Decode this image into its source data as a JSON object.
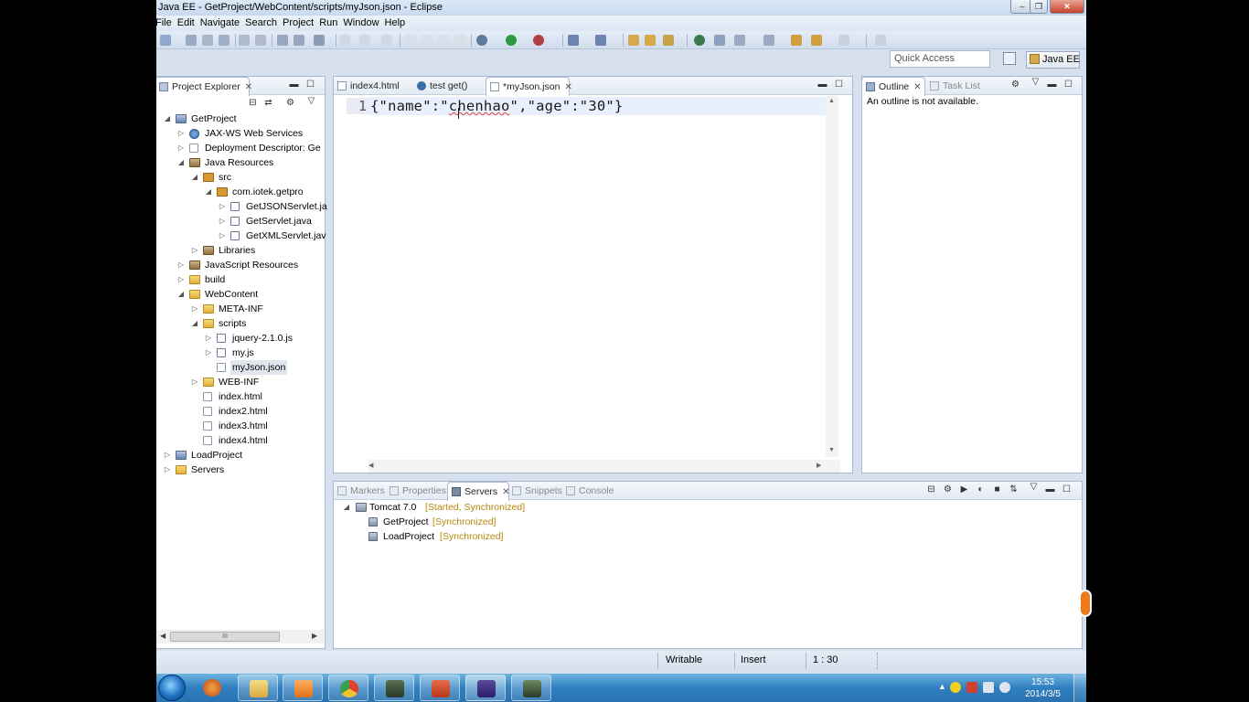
{
  "window": {
    "title": "Java EE - GetProject/WebContent/scripts/myJson.json - Eclipse",
    "controls": {
      "minimize": "‒",
      "restore": "❐",
      "close": "✕"
    }
  },
  "menu": [
    "File",
    "Edit",
    "Navigate",
    "Search",
    "Project",
    "Run",
    "Window",
    "Help"
  ],
  "quick_access": {
    "placeholder": "Quick Access"
  },
  "perspective": {
    "label": "Java EE"
  },
  "project_explorer": {
    "tab_label": "Project Explorer",
    "tree": [
      {
        "label": "GetProject",
        "twisty": "◢",
        "icon": "project-icon"
      },
      {
        "label": "JAX-WS Web Services",
        "twisty": "▷",
        "icon": "web-services-icon"
      },
      {
        "label": "Deployment Descriptor: Ge",
        "twisty": "▷",
        "icon": "descriptor-icon"
      },
      {
        "label": "Java Resources",
        "twisty": "◢",
        "icon": "java-resources-icon"
      },
      {
        "label": "src",
        "twisty": "◢",
        "icon": "source-folder-icon"
      },
      {
        "label": "com.iotek.getpro",
        "twisty": "◢",
        "icon": "package-icon"
      },
      {
        "label": "GetJSONServlet.ja",
        "twisty": "▷",
        "icon": "java-file-icon"
      },
      {
        "label": "GetServlet.java",
        "twisty": "▷",
        "icon": "java-file-icon"
      },
      {
        "label": "GetXMLServlet.jav",
        "twisty": "▷",
        "icon": "java-file-icon"
      },
      {
        "label": "Libraries",
        "twisty": "▷",
        "icon": "library-icon"
      },
      {
        "label": "JavaScript Resources",
        "twisty": "▷",
        "icon": "javascript-resources-icon"
      },
      {
        "label": "build",
        "twisty": "▷",
        "icon": "folder-icon"
      },
      {
        "label": "WebContent",
        "twisty": "◢",
        "icon": "folder-icon"
      },
      {
        "label": "META-INF",
        "twisty": "▷",
        "icon": "folder-icon"
      },
      {
        "label": "scripts",
        "twisty": "◢",
        "icon": "folder-icon"
      },
      {
        "label": "jquery-2.1.0.js",
        "twisty": "▷",
        "icon": "js-file-icon"
      },
      {
        "label": "my.js",
        "twisty": "▷",
        "icon": "js-file-icon"
      },
      {
        "label": "myJson.json",
        "twisty": "",
        "icon": "file-icon"
      },
      {
        "label": "WEB-INF",
        "twisty": "▷",
        "icon": "folder-icon"
      },
      {
        "label": "index.html",
        "twisty": "",
        "icon": "html-file-icon"
      },
      {
        "label": "index2.html",
        "twisty": "",
        "icon": "html-file-icon"
      },
      {
        "label": "index3.html",
        "twisty": "",
        "icon": "html-file-icon"
      },
      {
        "label": "index4.html",
        "twisty": "",
        "icon": "html-file-icon"
      },
      {
        "label": "LoadProject",
        "twisty": "▷",
        "icon": "project-icon"
      },
      {
        "label": "Servers",
        "twisty": "▷",
        "icon": "folder-icon"
      }
    ],
    "hscroll_grip": "III"
  },
  "editor": {
    "tabs": [
      {
        "label": "index4.html",
        "active": false
      },
      {
        "label": "test get()",
        "active": false
      },
      {
        "label": "*myJson.json",
        "active": true
      }
    ],
    "line_number": "1",
    "code_before": "{\"name\":\"",
    "code_squiggle": "chenhao",
    "code_after": "\",\"age\":\"30\"}"
  },
  "outline": {
    "tabs": [
      "Outline",
      "Task List"
    ],
    "message": "An outline is not available."
  },
  "bottom_panel": {
    "tabs": [
      "Markers",
      "Properties",
      "Servers",
      "Snippets",
      "Console"
    ],
    "servers": [
      {
        "name": "Tomcat 7.0",
        "state": "[Started, Synchronized]",
        "children": [
          {
            "name": "GetProject",
            "state": "[Synchronized]"
          },
          {
            "name": "LoadProject",
            "state": "[Synchronized]"
          }
        ]
      }
    ]
  },
  "status_bar": {
    "writable": "Writable",
    "mode": "Insert",
    "position": "1 : 30"
  },
  "taskbar": {
    "time": "15:53",
    "date": "2014/3/5"
  },
  "colors": {
    "accent": "#3a6fa8",
    "squiggle": "#e04040",
    "server_state": "#b8860b"
  }
}
